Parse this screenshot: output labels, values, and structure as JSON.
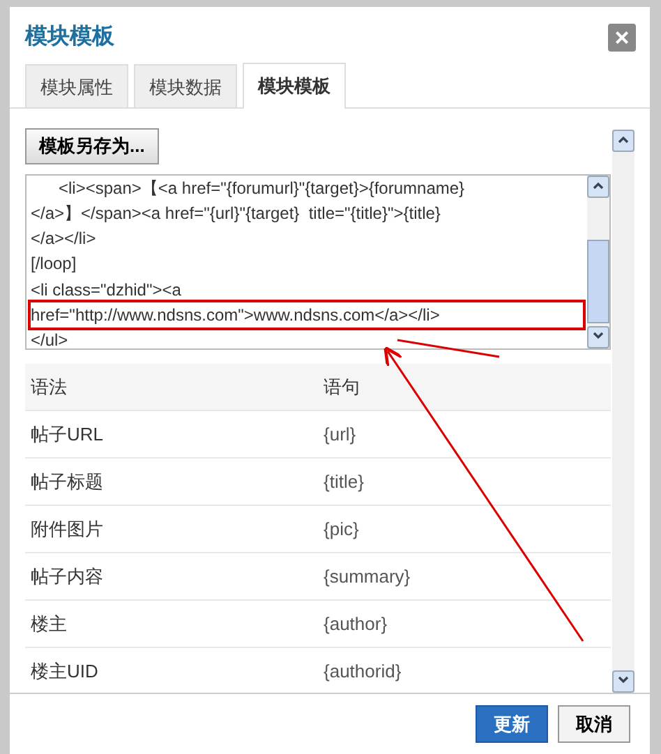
{
  "dialog": {
    "title": "模块模板",
    "close": "×"
  },
  "tabs": [
    {
      "label": "模块属性",
      "selected": false
    },
    {
      "label": "模块数据",
      "selected": false
    },
    {
      "label": "模块模板",
      "selected": true
    }
  ],
  "save_as_button": "模板另存为...",
  "template_code": {
    "lines": [
      {
        "text": "      <li><span>【<a href=\"{forumurl}\"{target}>{forumname}",
        "highlighted": false
      },
      {
        "text": "</a>】</span><a href=\"{url}\"{target}  title=\"{title}\">{title}",
        "highlighted": false
      },
      {
        "text": "</a></li>",
        "highlighted": false
      },
      {
        "text": "[/loop]",
        "highlighted": false
      },
      {
        "text": "<li class=\"dzhid\"><a",
        "highlighted": false
      },
      {
        "text": "href=\"http://www.ndsns.com\">www.ndsns.com</a></li>",
        "highlighted": true
      },
      {
        "text": "</ul>",
        "highlighted": false
      }
    ]
  },
  "table": {
    "columns": [
      "语法",
      "语句"
    ],
    "rows": [
      [
        "帖子URL",
        "{url}"
      ],
      [
        "帖子标题",
        "{title}"
      ],
      [
        "附件图片",
        "{pic}"
      ],
      [
        "帖子内容",
        "{summary}"
      ],
      [
        "楼主",
        "{author}"
      ],
      [
        "楼主UID",
        "{authorid}"
      ]
    ]
  },
  "buttons": [
    {
      "label": "更新",
      "kind": "primary"
    },
    {
      "label": "取消",
      "kind": "secondary"
    }
  ]
}
